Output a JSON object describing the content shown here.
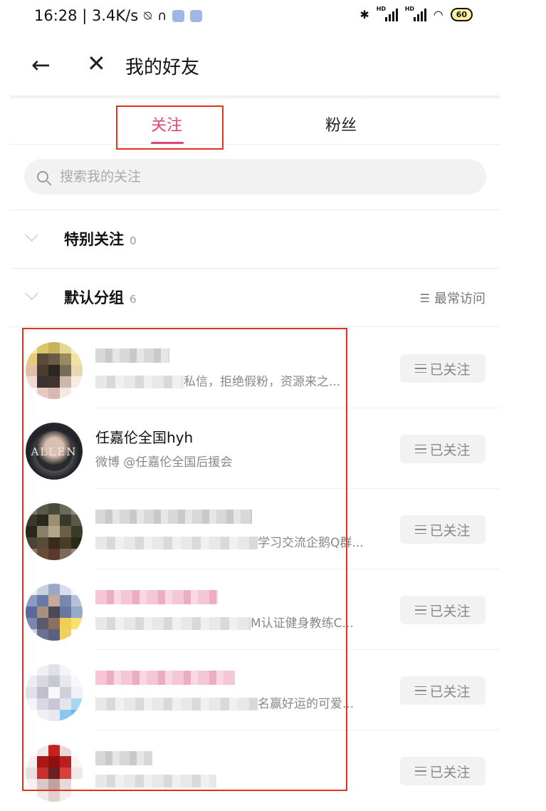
{
  "status_bar": {
    "time_speed": "16:28 | 3.4K/s",
    "battery": "60"
  },
  "header": {
    "title": "我的好友"
  },
  "tabs": [
    {
      "label": "关注",
      "active": true
    },
    {
      "label": "粉丝",
      "active": false
    }
  ],
  "search": {
    "placeholder": "搜索我的关注"
  },
  "groups": [
    {
      "name": "特别关注",
      "count": "0"
    },
    {
      "name": "默认分组",
      "count": "6",
      "sort_label": "最常访问"
    }
  ],
  "accent_color": "#e0457b",
  "list": [
    {
      "name": "",
      "desc_tail": "私信，拒绝假粉，资源来之...",
      "button": "已关注",
      "blurred": true
    },
    {
      "name": "任嘉伦全国hyh",
      "desc": "微博 @任嘉伦全国后援会",
      "button": "已关注",
      "blurred": false,
      "avatar_text": "ALLEN"
    },
    {
      "name": "",
      "desc_tail": "学习交流企鹅Q群...",
      "button": "已关注",
      "blurred": true
    },
    {
      "name": "",
      "desc_tail": "M认证健身教练C...",
      "button": "已关注",
      "blurred": true
    },
    {
      "name": "",
      "desc_tail": "名赢好运的可爱...",
      "button": "已关注",
      "blurred": true
    },
    {
      "name": "",
      "desc_tail": "",
      "button": "已关注",
      "blurred": true
    }
  ]
}
